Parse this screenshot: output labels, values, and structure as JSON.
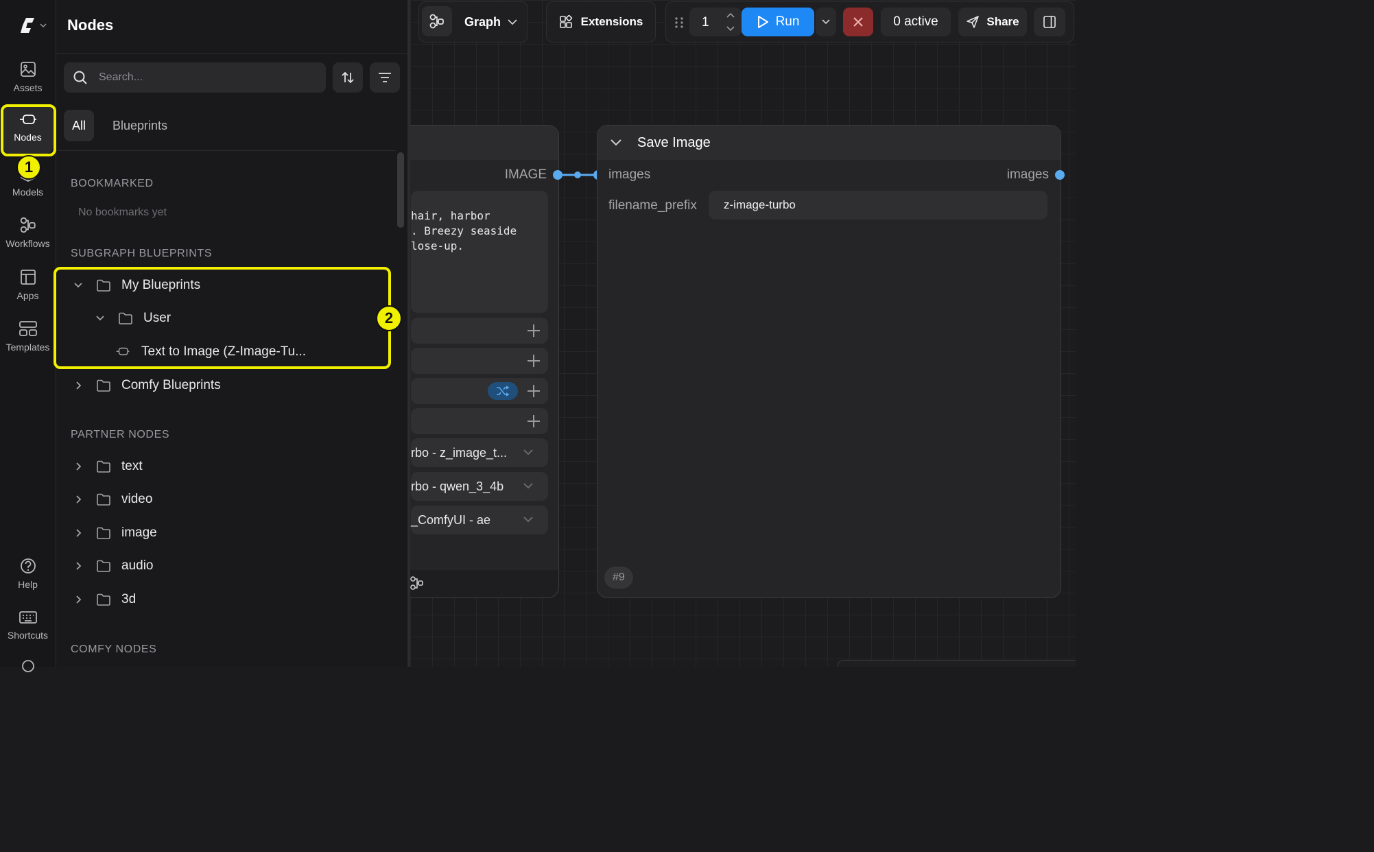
{
  "rail": {
    "items": [
      {
        "label": "Assets",
        "icon": "image-icon"
      },
      {
        "label": "Nodes",
        "icon": "node-icon"
      },
      {
        "label": "Models",
        "icon": "cube-icon"
      },
      {
        "label": "Workflows",
        "icon": "workflow-icon"
      },
      {
        "label": "Apps",
        "icon": "layout-icon"
      },
      {
        "label": "Templates",
        "icon": "templates-icon"
      }
    ],
    "bottom": [
      {
        "label": "Help",
        "icon": "help-icon"
      },
      {
        "label": "Shortcuts",
        "icon": "keyboard-icon"
      }
    ]
  },
  "panel": {
    "title": "Nodes",
    "search_placeholder": "Search...",
    "tabs": [
      "All",
      "Blueprints"
    ],
    "sections": {
      "bookmarked": "BOOKMARKED",
      "bookmarked_empty": "No bookmarks yet",
      "subgraph": "SUBGRAPH BLUEPRINTS",
      "partner": "PARTNER NODES",
      "comfy": "COMFY NODES"
    },
    "tree": {
      "my_blueprints": "My Blueprints",
      "user": "User",
      "blueprint_item": "Text to Image (Z-Image-Tu...",
      "comfy_blueprints": "Comfy Blueprints"
    },
    "partner_folders": [
      "text",
      "video",
      "image",
      "audio",
      "3d"
    ]
  },
  "toolbar": {
    "graph_label": "Graph",
    "extensions_label": "Extensions",
    "queue_count": "1",
    "run_label": "Run",
    "active_label": "0 active",
    "share_label": "Share"
  },
  "left_node": {
    "output_label": "IMAGE",
    "prompt_lines": [
      "hair, harbor",
      ". Breezy seaside",
      "lose-up."
    ],
    "selects": [
      "rbo - z_image_t...",
      "rbo - qwen_3_4b",
      "_ComfyUI - ae"
    ]
  },
  "save_node": {
    "title": "Save Image",
    "input_label": "images",
    "output_label": "images",
    "widget_label": "filename_prefix",
    "widget_value": "z-image-turbo",
    "id_badge": "#9"
  },
  "annotations": [
    "1",
    "2"
  ],
  "colors": {
    "accent": "#1e88f5",
    "highlight": "#f0f000",
    "link": "#5aaaf0",
    "cancel": "#8b2b2b"
  }
}
